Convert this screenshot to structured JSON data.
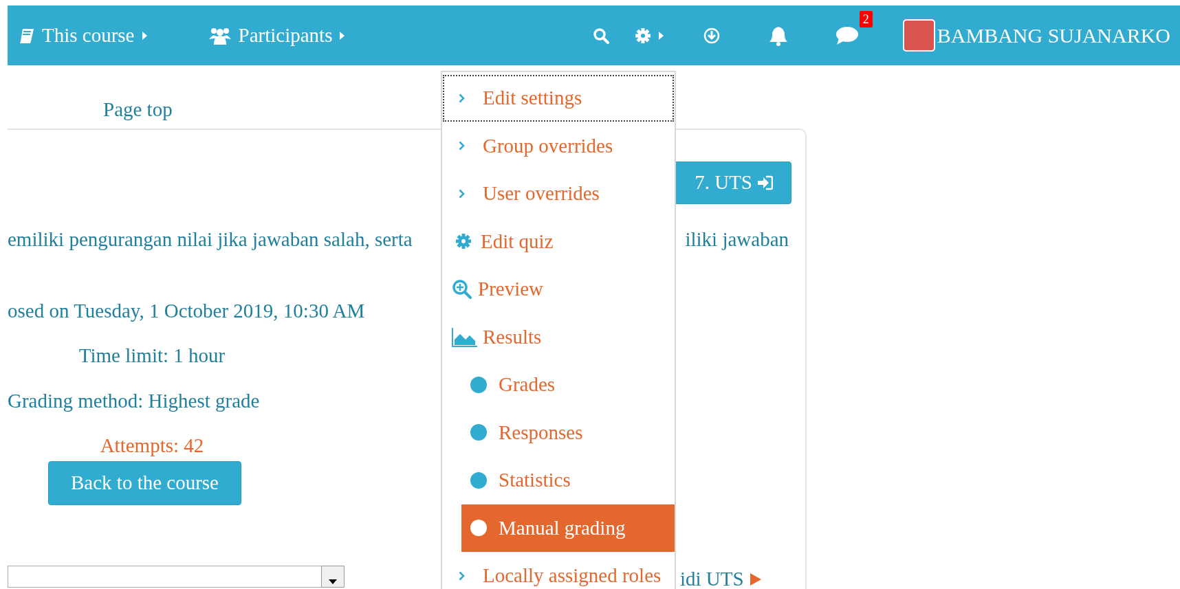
{
  "navbar": {
    "links": [
      {
        "label": "This course"
      },
      {
        "label": "Participants"
      }
    ],
    "message_count": "2",
    "user_name": "BAMBANG SUJANARKO"
  },
  "page_top_link": "Page top",
  "next_activity_button": "7. UTS",
  "description": [
    "emiliki pengurangan nilai jika jawaban salah, serta",
    "iliki jawaban"
  ],
  "closed_on": "osed on Tuesday, 1 October 2019, 10:30 AM",
  "time_limit": "Time limit: 1 hour",
  "grading_method": "Grading method: Highest grade",
  "attempts_link": "Attempts: 42",
  "back_button": "Back to the course",
  "next_link": "idi UTS",
  "settings_menu": {
    "items": [
      {
        "label": "Edit settings",
        "kind": "chevron",
        "focused": true,
        "selected": false
      },
      {
        "label": "Group overrides",
        "kind": "chevron",
        "focused": false,
        "selected": false
      },
      {
        "label": "User overrides",
        "kind": "chevron",
        "focused": false,
        "selected": false
      },
      {
        "label": "Edit quiz",
        "kind": "gear",
        "focused": false,
        "selected": false
      },
      {
        "label": "Preview",
        "kind": "preview",
        "focused": false,
        "selected": false
      },
      {
        "label": "Results",
        "kind": "chart",
        "focused": false,
        "selected": false,
        "children": [
          {
            "label": "Grades",
            "kind": "dot",
            "focused": false,
            "selected": false
          },
          {
            "label": "Responses",
            "kind": "dot",
            "focused": false,
            "selected": false
          },
          {
            "label": "Statistics",
            "kind": "dot",
            "focused": false,
            "selected": false
          },
          {
            "label": "Manual grading",
            "kind": "dot",
            "focused": false,
            "selected": true
          }
        ]
      },
      {
        "label": "Locally assigned roles",
        "kind": "chevron",
        "focused": false,
        "selected": false
      }
    ]
  }
}
